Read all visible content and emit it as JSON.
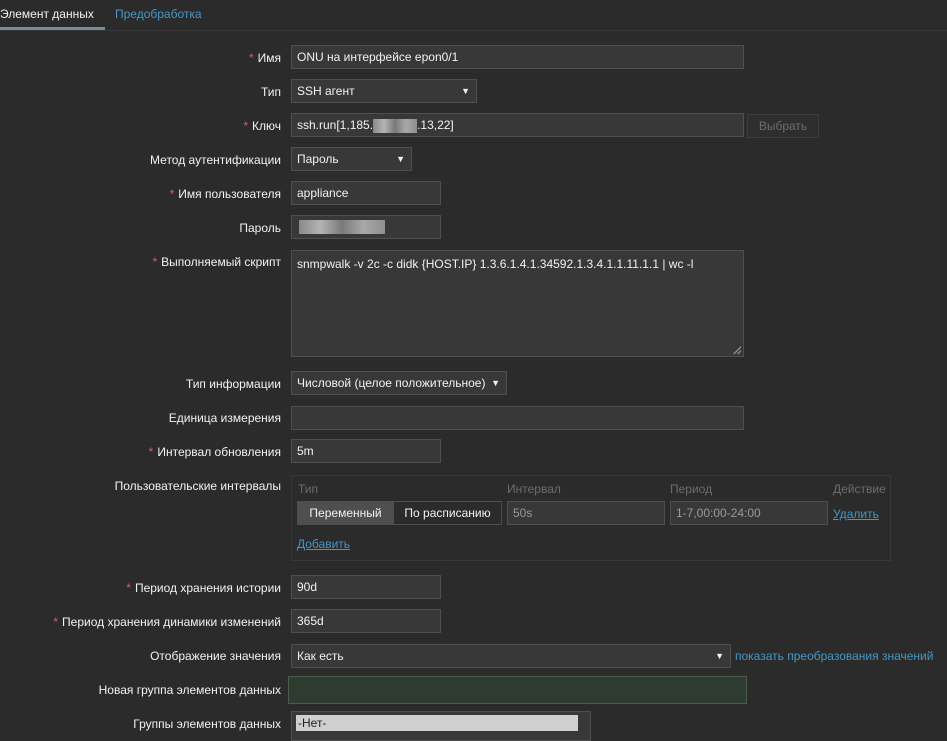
{
  "tabs": {
    "item": "Элемент данных",
    "preprocessing": "Предобработка"
  },
  "form": {
    "name": {
      "label": "Имя",
      "value": "ONU на интерфейсе epon0/1"
    },
    "type": {
      "label": "Тип",
      "value": "SSH агент"
    },
    "key": {
      "label": "Ключ",
      "value_prefix": "ssh.run[1,185.",
      "value_suffix": ".13,22]",
      "select_button": "Выбрать"
    },
    "auth_method": {
      "label": "Метод аутентификации",
      "value": "Пароль"
    },
    "username": {
      "label": "Имя пользователя",
      "value": "appliance"
    },
    "password": {
      "label": "Пароль"
    },
    "script": {
      "label": "Выполняемый скрипт",
      "value": "snmpwalk -v 2c -c didk {HOST.IP} 1.3.6.1.4.1.34592.1.3.4.1.1.11.1.1 | wc -l"
    },
    "info_type": {
      "label": "Тип информации",
      "value": "Числовой (целое положительное)"
    },
    "units": {
      "label": "Единица измерения",
      "value": ""
    },
    "update_interval": {
      "label": "Интервал обновления",
      "value": "5m"
    },
    "custom_intervals": {
      "label": "Пользовательские интервалы",
      "headers": {
        "type": "Тип",
        "interval": "Интервал",
        "period": "Период",
        "action": "Действие"
      },
      "row": {
        "flexible": "Переменный",
        "scheduling": "По расписанию",
        "interval": "50s",
        "period": "1-7,00:00-24:00",
        "remove": "Удалить"
      },
      "add": "Добавить"
    },
    "history": {
      "label": "Период хранения истории",
      "value": "90d"
    },
    "trends": {
      "label": "Период хранения динамики изменений",
      "value": "365d"
    },
    "valuemap": {
      "label": "Отображение значения",
      "value": "Как есть",
      "link": "показать преобразования значений"
    },
    "new_app": {
      "label": "Новая группа элементов данных",
      "value": ""
    },
    "apps": {
      "label": "Группы элементов данных",
      "item": "-Нет-"
    }
  },
  "colors": {
    "background": "#2b2b2b",
    "link": "#4796c4",
    "required": "#e45959",
    "field": "#383838"
  }
}
